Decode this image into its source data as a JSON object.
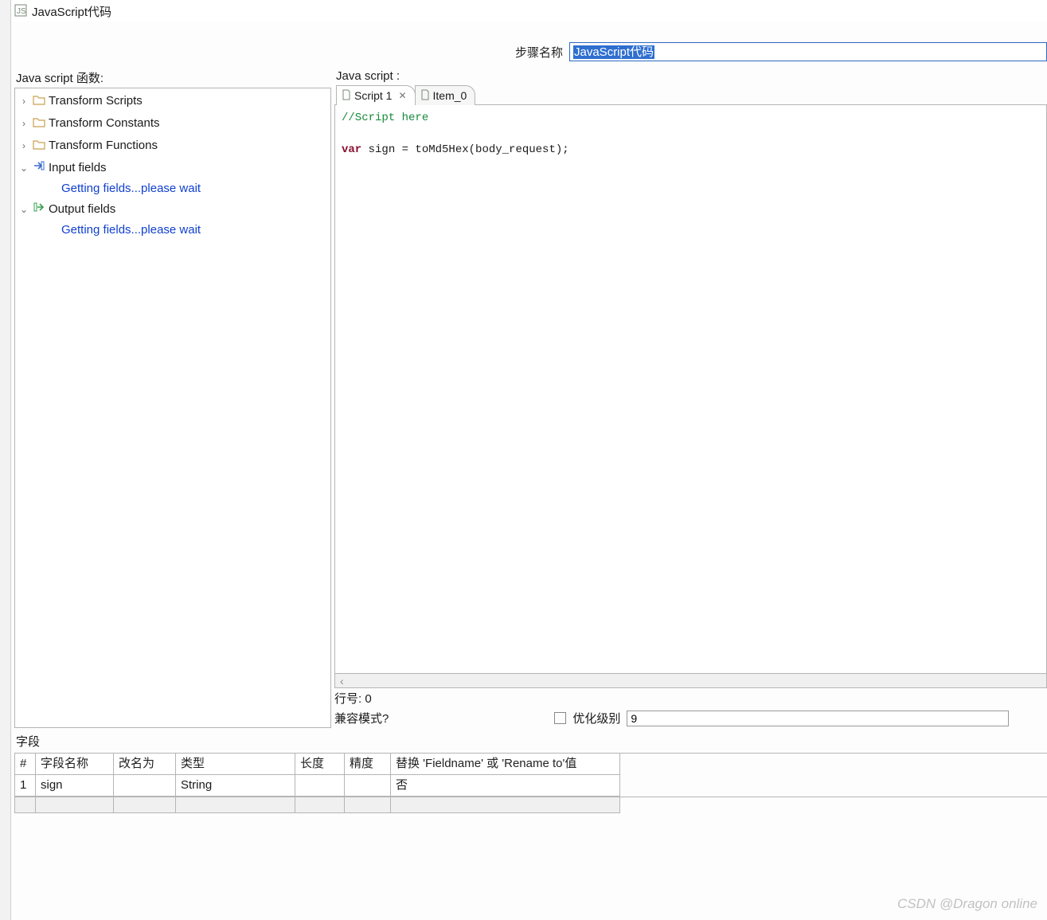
{
  "window": {
    "title": "JavaScript代码"
  },
  "step": {
    "label": "步骤名称",
    "value": "JavaScript代码"
  },
  "left": {
    "heading": "Java script 函数:",
    "items": [
      {
        "label": "Transform Scripts",
        "kind": "folder",
        "expander": "›"
      },
      {
        "label": "Transform Constants",
        "kind": "folder",
        "expander": "›"
      },
      {
        "label": "Transform Functions",
        "kind": "folder",
        "expander": "›"
      },
      {
        "label": "Input fields",
        "kind": "input",
        "expander": "⌄",
        "leaf": "Getting fields...please wait"
      },
      {
        "label": "Output fields",
        "kind": "output",
        "expander": "⌄",
        "leaf": "Getting fields...please wait"
      }
    ]
  },
  "right": {
    "heading": "Java script :",
    "tabs": [
      {
        "label": "Script 1",
        "active": true,
        "closable": true
      },
      {
        "label": "Item_0",
        "active": false,
        "closable": false
      }
    ],
    "code": {
      "comment": "//Script here",
      "kw": "var",
      "rest": " sign = toMd5Hex(body_request);"
    },
    "scroll_hint": "‹",
    "line_label": "行号: 0",
    "compat_label": "兼容模式?",
    "opt_label": "优化级别",
    "opt_value": "9"
  },
  "fields": {
    "heading": "字段",
    "headers": [
      "#",
      "字段名称",
      "改名为",
      "类型",
      "长度",
      "精度",
      "替换 'Fieldname' 或 'Rename to'值"
    ],
    "rows": [
      {
        "idx": "1",
        "name": "sign",
        "rename": "",
        "type": "String",
        "len": "",
        "prec": "",
        "replace": "否"
      }
    ]
  },
  "watermark": "CSDN @Dragon online"
}
